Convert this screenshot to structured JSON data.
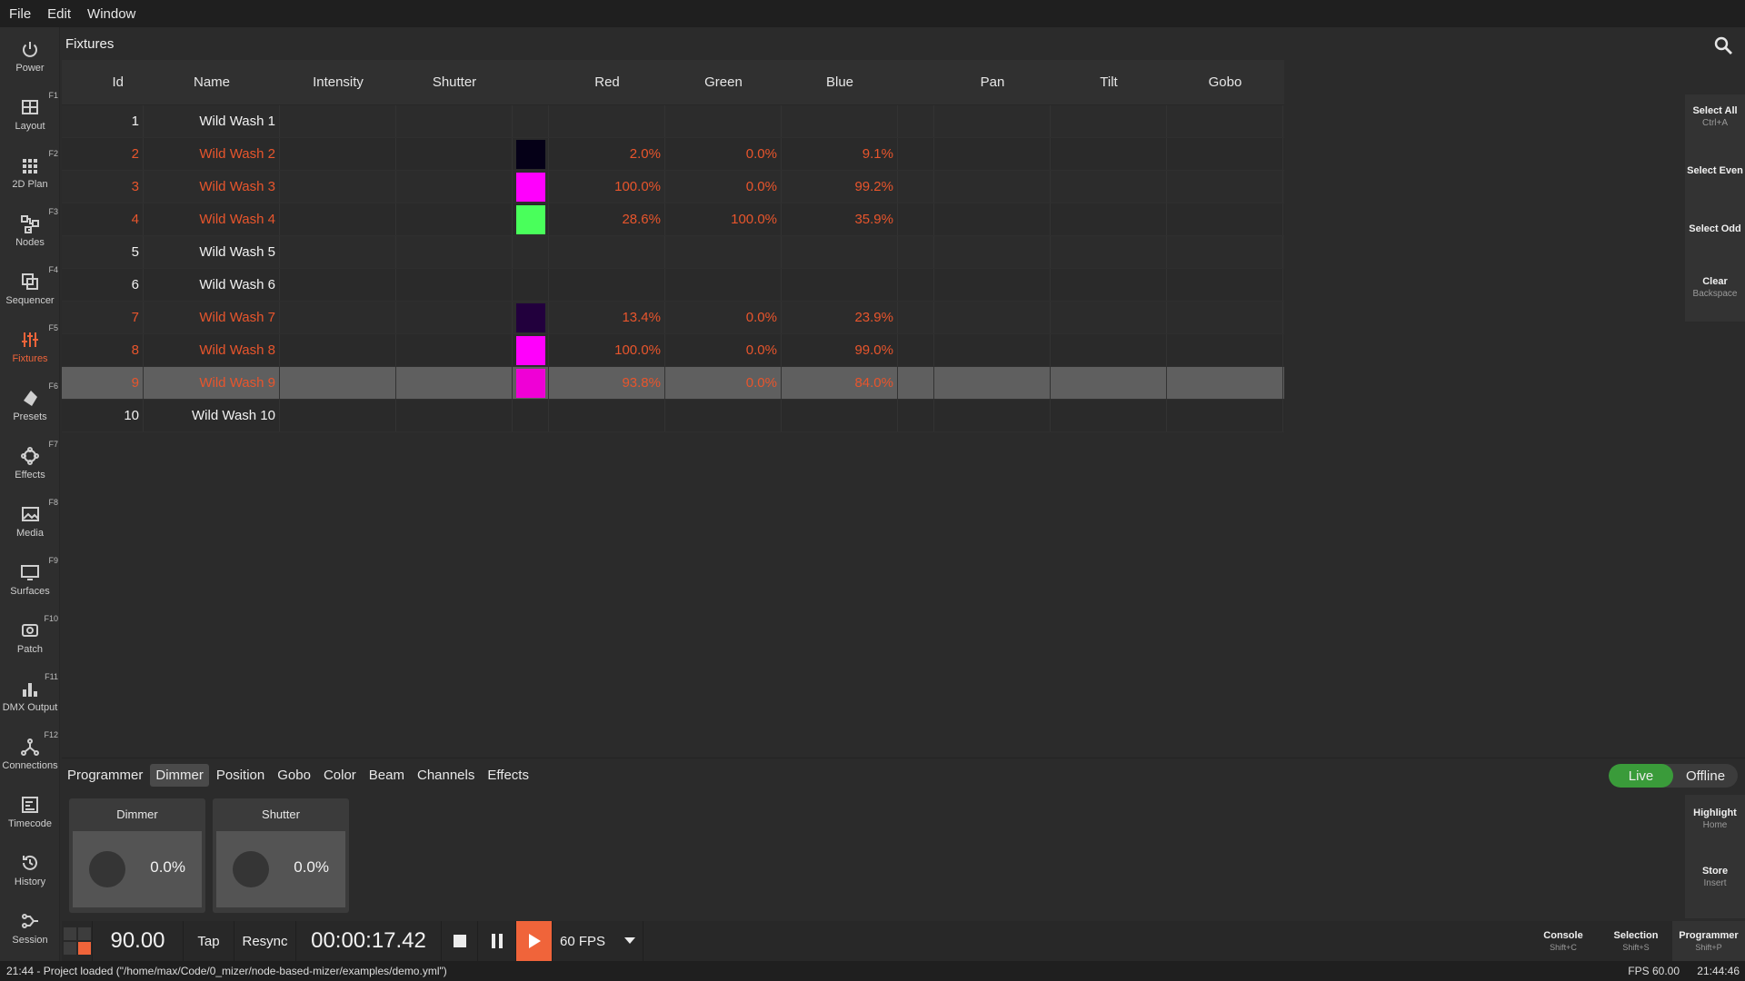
{
  "menu": [
    "File",
    "Edit",
    "Window"
  ],
  "sidebar": [
    {
      "label": "Power",
      "key": "",
      "icon": "power-icon"
    },
    {
      "label": "Layout",
      "key": "F1",
      "icon": "layout-icon"
    },
    {
      "label": "2D Plan",
      "key": "F2",
      "icon": "grid-plan-icon"
    },
    {
      "label": "Nodes",
      "key": "F3",
      "icon": "nodes-icon"
    },
    {
      "label": "Sequencer",
      "key": "F4",
      "icon": "sequencer-icon"
    },
    {
      "label": "Fixtures",
      "key": "F5",
      "icon": "sliders-icon",
      "active": true
    },
    {
      "label": "Presets",
      "key": "F6",
      "icon": "presets-icon"
    },
    {
      "label": "Effects",
      "key": "F7",
      "icon": "effects-icon"
    },
    {
      "label": "Media",
      "key": "F8",
      "icon": "media-icon"
    },
    {
      "label": "Surfaces",
      "key": "F9",
      "icon": "surfaces-icon"
    },
    {
      "label": "Patch",
      "key": "F10",
      "icon": "patch-icon"
    },
    {
      "label": "DMX Output",
      "key": "F11",
      "icon": "bar-chart-icon"
    },
    {
      "label": "Connections",
      "key": "F12",
      "icon": "connections-icon"
    },
    {
      "label": "Timecode",
      "key": "",
      "icon": "timecode-icon"
    },
    {
      "label": "History",
      "key": "",
      "icon": "history-icon"
    },
    {
      "label": "Session",
      "key": "",
      "icon": "session-icon"
    }
  ],
  "fixtures": {
    "title": "Fixtures",
    "columns": {
      "id": "Id",
      "name": "Name",
      "intensity": "Intensity",
      "shutter": "Shutter",
      "red": "Red",
      "green": "Green",
      "blue": "Blue",
      "pan": "Pan",
      "tilt": "Tilt",
      "gobo": "Gobo"
    },
    "rows": [
      {
        "id": "1",
        "name": "Wild Wash 1",
        "red": "",
        "green": "",
        "blue": "",
        "color": "",
        "state": "white"
      },
      {
        "id": "2",
        "name": "Wild Wash 2",
        "red": "2.0%",
        "green": "0.0%",
        "blue": "9.1%",
        "color": "#050017",
        "state": "orange"
      },
      {
        "id": "3",
        "name": "Wild Wash 3",
        "red": "100.0%",
        "green": "0.0%",
        "blue": "99.2%",
        "color": "#ff00fd",
        "state": "orange"
      },
      {
        "id": "4",
        "name": "Wild Wash 4",
        "red": "28.6%",
        "green": "100.0%",
        "blue": "35.9%",
        "color": "#49ff5b",
        "state": "orange"
      },
      {
        "id": "5",
        "name": "Wild Wash 5",
        "red": "",
        "green": "",
        "blue": "",
        "color": "",
        "state": "white"
      },
      {
        "id": "6",
        "name": "Wild Wash 6",
        "red": "",
        "green": "",
        "blue": "",
        "color": "",
        "state": "white"
      },
      {
        "id": "7",
        "name": "Wild Wash 7",
        "red": "13.4%",
        "green": "0.0%",
        "blue": "23.9%",
        "color": "#22003d",
        "state": "orange"
      },
      {
        "id": "8",
        "name": "Wild Wash 8",
        "red": "100.0%",
        "green": "0.0%",
        "blue": "99.0%",
        "color": "#ff00fc",
        "state": "orange"
      },
      {
        "id": "9",
        "name": "Wild Wash 9",
        "red": "93.8%",
        "green": "0.0%",
        "blue": "84.0%",
        "color": "#ef00d6",
        "state": "orange",
        "selected": true
      },
      {
        "id": "10",
        "name": "Wild Wash 10",
        "red": "",
        "green": "",
        "blue": "",
        "color": "",
        "state": "white"
      }
    ]
  },
  "selection_actions": [
    {
      "label": "Select All",
      "key": "Ctrl+A"
    },
    {
      "label": "Select Even",
      "key": ""
    },
    {
      "label": "Select Odd",
      "key": ""
    },
    {
      "label": "Clear",
      "key": "Backspace"
    }
  ],
  "programmer": {
    "tabs": [
      "Programmer",
      "Dimmer",
      "Position",
      "Gobo",
      "Color",
      "Beam",
      "Channels",
      "Effects"
    ],
    "active_tab": "Dimmer",
    "live": "Live",
    "offline": "Offline",
    "faders": [
      {
        "label": "Dimmer",
        "value": "0.0%"
      },
      {
        "label": "Shutter",
        "value": "0.0%"
      }
    ],
    "actions": [
      {
        "label": "Highlight",
        "key": "Home"
      },
      {
        "label": "Store",
        "key": "Insert"
      }
    ]
  },
  "transport": {
    "bpm": "90.00",
    "tap": "Tap",
    "resync": "Resync",
    "time": "00:00:17.42",
    "fps": "60 FPS"
  },
  "view_tabs": [
    {
      "label": "Console",
      "key": "Shift+C"
    },
    {
      "label": "Selection",
      "key": "Shift+S"
    },
    {
      "label": "Programmer",
      "key": "Shift+P"
    }
  ],
  "status": {
    "message": "21:44 - Project loaded (\"/home/max/Code/0_mizer/node-based-mizer/examples/demo.yml\")",
    "fps": "FPS 60.00",
    "clock": "21:44:46"
  },
  "colors": {
    "accent": "#f0643a",
    "live": "#3a9b3a",
    "selected_row": "#5f5f5f"
  }
}
